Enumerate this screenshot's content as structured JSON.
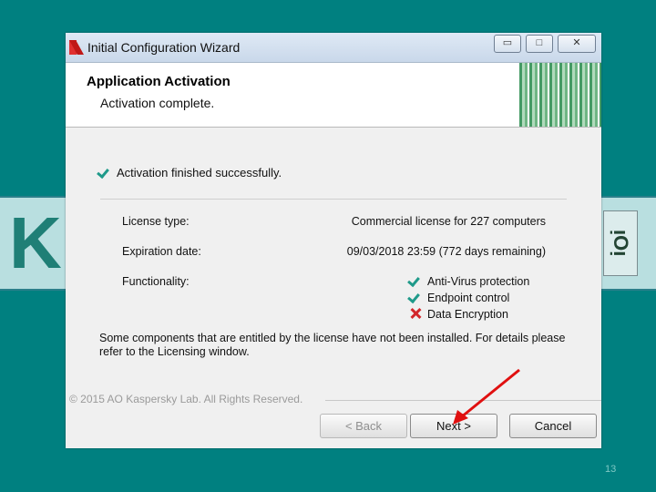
{
  "background": {
    "banner_text": "K",
    "side_text": "ᴉOᴉ"
  },
  "dialog": {
    "title": "Initial Configuration Wizard",
    "header_title": "Application Activation",
    "header_subtitle": "Activation complete.",
    "status": "Activation finished successfully.",
    "rows": [
      {
        "label": "License type:",
        "value": "Commercial license for 227 computers"
      },
      {
        "label": "Expiration date:",
        "value": "09/03/2018 23:59 (772 days remaining)"
      },
      {
        "label": "Functionality:",
        "value": ""
      }
    ],
    "functionality": [
      {
        "name": "Anti-Virus protection",
        "status": "check-icon"
      },
      {
        "name": "Endpoint control",
        "status": "check-icon"
      },
      {
        "name": "Data Encryption",
        "status": "cross-icon"
      }
    ],
    "note": "Some components that are entitled by the license have not been installed. For details please refer to the Licensing window.",
    "copyright": "© 2015 AO Kaspersky Lab. All Rights Reserved.",
    "buttons": {
      "back": "< Back",
      "next": "Next >",
      "cancel": "Cancel"
    },
    "window_controls": {
      "minimize": "▭",
      "maximize": "□",
      "close": "✕"
    }
  },
  "page_number": "13",
  "colors": {
    "background": "#008080",
    "check": "#1f9a8a",
    "cross": "#d2262b",
    "arrow": "#e01010"
  }
}
